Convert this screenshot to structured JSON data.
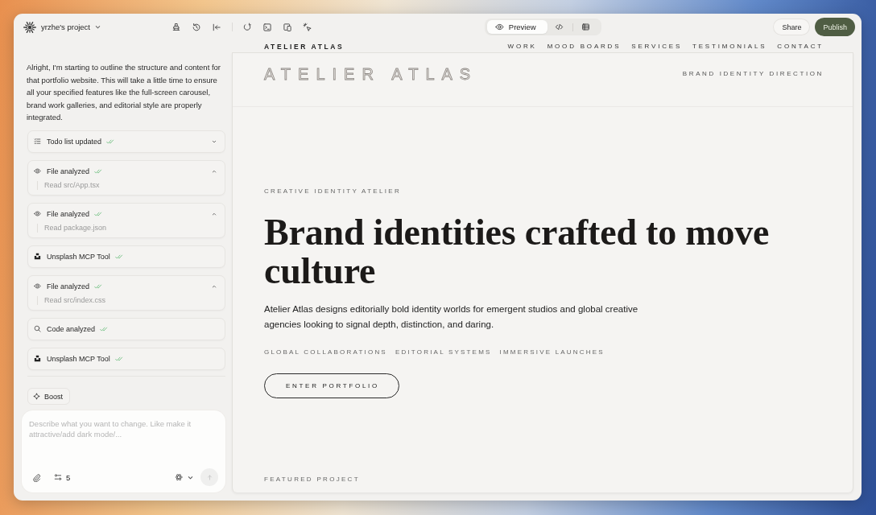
{
  "project": {
    "name": "yrzhe's project"
  },
  "view_tabs": [
    {
      "kind": "preview",
      "label": "Preview",
      "selected": true
    },
    {
      "kind": "code",
      "selected": false
    },
    {
      "kind": "table",
      "selected": false
    }
  ],
  "actions": [
    {
      "kind": "secondary",
      "label": "Share"
    },
    {
      "kind": "primary",
      "label": "Publish"
    }
  ],
  "chat": {
    "message": "Alright, I'm starting to outline the structure and content for that portfolio website. This will take a little time to ensure all your specified features like the full-screen carousel, brand work galleries, and editorial style are properly integrated.",
    "steps": [
      {
        "kind": "todo",
        "label": "Todo list updated",
        "expanded": false
      },
      {
        "kind": "file",
        "label": "File analyzed",
        "expanded": true,
        "detail": "Read src/App.tsx"
      },
      {
        "kind": "file",
        "label": "File analyzed",
        "expanded": true,
        "detail": "Read package.json"
      },
      {
        "kind": "tool",
        "label": "Unsplash MCP Tool"
      },
      {
        "kind": "file",
        "label": "File analyzed",
        "expanded": true,
        "detail": "Read src/index.css"
      },
      {
        "kind": "search",
        "label": "Code analyzed"
      },
      {
        "kind": "tool",
        "label": "Unsplash MCP Tool"
      }
    ],
    "boost": {
      "label": "Boost"
    },
    "composer": {
      "placeholder": "Describe what you want to change. Like make it attractive/add dark mode/...",
      "count": "5",
      "send_disabled": true
    }
  },
  "preview": {
    "brand": "ATELIER ATLAS",
    "nav": [
      "WORK",
      "MOOD BOARDS",
      "SERVICES",
      "TESTIMONIALS",
      "CONTACT"
    ],
    "wordmark": "ATELIER ATLAS",
    "tagline": "BRAND IDENTITY DIRECTION",
    "eyebrow": "CREATIVE IDENTITY ATELIER",
    "headline": "Brand identities crafted to move culture",
    "intro": "Atelier Atlas designs editorially bold identity worlds for emergent studios and global creative agencies looking to signal depth, distinction, and daring.",
    "tags": [
      "GLOBAL COLLABORATIONS",
      "EDITORIAL SYSTEMS",
      "IMMERSIVE LAUNCHES"
    ],
    "cta": "ENTER PORTFOLIO",
    "section_label": "FEATURED PROJECT"
  }
}
